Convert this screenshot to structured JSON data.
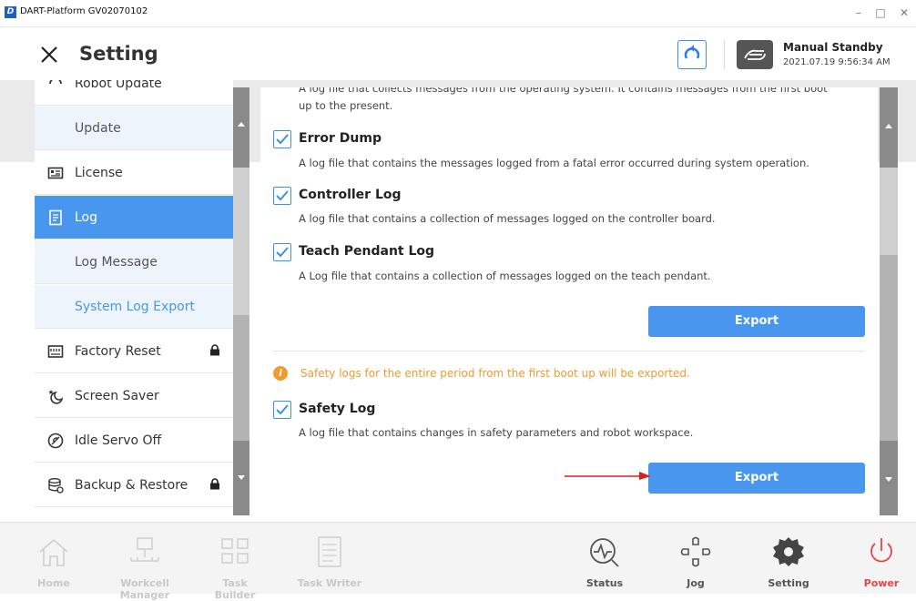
{
  "window": {
    "title": "DART-Platform GV02070102",
    "minimize": "–",
    "maximize": "□",
    "close": "✕"
  },
  "header": {
    "title": "Setting",
    "status_mode": "Manual Standby",
    "status_time": "2021.07.19 9:56:34 AM"
  },
  "sidebar": {
    "items": [
      {
        "label": "Robot Update",
        "icon": "robot-update-icon",
        "type": "main"
      },
      {
        "label": "Update",
        "type": "sub"
      },
      {
        "label": "License",
        "icon": "license-icon",
        "type": "main"
      },
      {
        "label": "Log",
        "icon": "log-icon",
        "type": "main",
        "active": true
      },
      {
        "label": "Log Message",
        "type": "sub"
      },
      {
        "label": "System Log Export",
        "type": "sub",
        "selected": true
      },
      {
        "label": "Factory Reset",
        "icon": "factory-reset-icon",
        "type": "main",
        "locked": true
      },
      {
        "label": "Screen Saver",
        "icon": "screen-saver-icon",
        "type": "main"
      },
      {
        "label": "Idle Servo Off",
        "icon": "idle-servo-off-icon",
        "type": "main"
      },
      {
        "label": "Backup & Restore",
        "icon": "backup-restore-icon",
        "type": "main",
        "locked": true
      }
    ]
  },
  "content": {
    "top_desc_1": "A log file that collects messages from the operating system. It contains messages from the first boot",
    "top_desc_2": "up to the present.",
    "options": [
      {
        "label": "Error Dump",
        "desc": "A log file that contains the messages logged from a fatal error occurred during system operation.",
        "checked": true
      },
      {
        "label": "Controller Log",
        "desc": "A log file that contains a collection of messages logged on the controller board.",
        "checked": true
      },
      {
        "label": "Teach Pendant Log",
        "desc": "A Log file that contains a collection of messages logged on the teach pendant.",
        "checked": true
      }
    ],
    "export_label": "Export",
    "safety_warning": "Safety logs for the entire period from the first boot up will be exported.",
    "safety_option": {
      "label": "Safety Log",
      "desc": "A log file that contains changes in safety parameters and robot workspace.",
      "checked": true
    },
    "export2_label": "Export"
  },
  "bottom_nav": {
    "items": [
      {
        "label": "Home",
        "icon": "home-icon",
        "enabled": false
      },
      {
        "label": "Workcell Manager",
        "icon": "workcell-manager-icon",
        "enabled": false
      },
      {
        "label": "Task Builder",
        "icon": "task-builder-icon",
        "enabled": false
      },
      {
        "label": "Task Writer",
        "icon": "task-writer-icon",
        "enabled": false
      },
      {
        "label": "Status",
        "icon": "status-icon",
        "enabled": true
      },
      {
        "label": "Jog",
        "icon": "jog-icon",
        "enabled": true
      },
      {
        "label": "Setting",
        "icon": "setting-icon",
        "enabled": true
      },
      {
        "label": "Power",
        "icon": "power-icon",
        "enabled": true
      }
    ]
  },
  "colors": {
    "accent": "#4896ee",
    "warning": "#f29a2e",
    "power": "#e64545",
    "annotation_arrow": "#d62020"
  }
}
